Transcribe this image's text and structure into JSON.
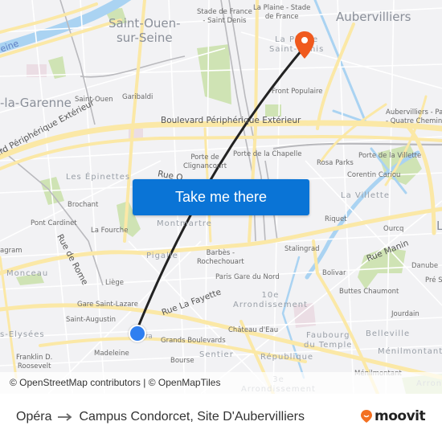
{
  "map": {
    "cta_label": "Take me there",
    "attribution": "© OpenStreetMap contributors | © OpenMapTiles",
    "colors": {
      "background": "#f2f2f4",
      "major_road": "#fbe8a6",
      "water": "#aad3f2",
      "park": "#cfe3b4",
      "route_line": "#222222",
      "origin_marker": "#2f7ff0",
      "destination_marker": "#f05a1e",
      "cta": "#0a74d6"
    },
    "labels": {
      "saint_ouen_city": "Saint-Ouen-\nsur-Seine",
      "aubervilliers": "Aubervilliers",
      "la_garenne": "-la-Garenne",
      "seine": "eine",
      "stade_de_france": "Stade de France\n- Saint Denis",
      "la_plaine": "La Plaine - Stade\nde France",
      "la_plaine_st_denis": "La Plaine\nSaint-Denis",
      "saint_ouen": "Saint-Ouen",
      "garibaldi": "Garibaldi",
      "front_populaire": "Front Populaire",
      "periph_top": "Boulevard Périphérique Extérieur",
      "periph_left": "ard Périphérique Extérieur",
      "aubervilliers_pantin": "Aubervilliers - Pantin\n- Quatre Chemins",
      "porte_clignancourt": "Porte de\nClignancourt",
      "porte_chapelle": "Porte de la Chapelle",
      "rosa_parks": "Rosa Parks",
      "porte_villette": "Porte de la Villette",
      "corentin_cariou": "Corentin Cariou",
      "les_epinettes": "Les Épinettes",
      "rue_o": "Rue O",
      "brochant": "Brochant",
      "la_villette": "La Villette",
      "pont_cardinet": "Pont Cardinet",
      "la_fourche": "La Fourche",
      "montmartre": "Montmartre",
      "riquet": "Riquet",
      "ourcq": "Ourcq",
      "rue_de_rome": "Rue de Rome",
      "wagram": "agram",
      "pigalle": "Pigalle",
      "barbes": "Barbès -\nRochechouart",
      "stalingrad": "Stalingrad",
      "rue_manin": "Rue Manin",
      "danube": "Danube",
      "monceau": "Monceau",
      "liege": "Liège",
      "gare_du_nord": "Paris Gare du Nord",
      "bolivar": "Bolivar",
      "pre_st": "Pré Sa",
      "buttes_chaumont": "Buttes Chaumont",
      "gare_st_lazare": "Gare Saint-Lazare",
      "rue_la_fayette": "Rue La Fayette",
      "tenth": "10e\nArrondissement",
      "saint_augustin": "Saint-Augustin",
      "jourdain": "Jourdain",
      "champs": "s-Elysées",
      "opera": "ra",
      "grands_boulevards": "Grands Boulevards",
      "chateau_deau": "Château d'Eau",
      "faubourg": "Faubourg\ndu Temple",
      "belleville": "Belleville",
      "franklin": "Franklin D.\nRoosevelt",
      "madeleine": "Madeleine",
      "sentier": "Sentier",
      "bourse": "Bourse",
      "republique": "République",
      "menilmontant_district": "Ménilmontant",
      "menilmontant": "Ménilmontant",
      "third": "3e\nArrondissement",
      "arrond_right": "Arron",
      "l_right": "L"
    }
  },
  "footer": {
    "origin": "Opéra",
    "arrow_icon": "arrow-right-icon",
    "destination": "Campus Condorcet, Site D'Aubervilliers",
    "brand": "moovit"
  }
}
